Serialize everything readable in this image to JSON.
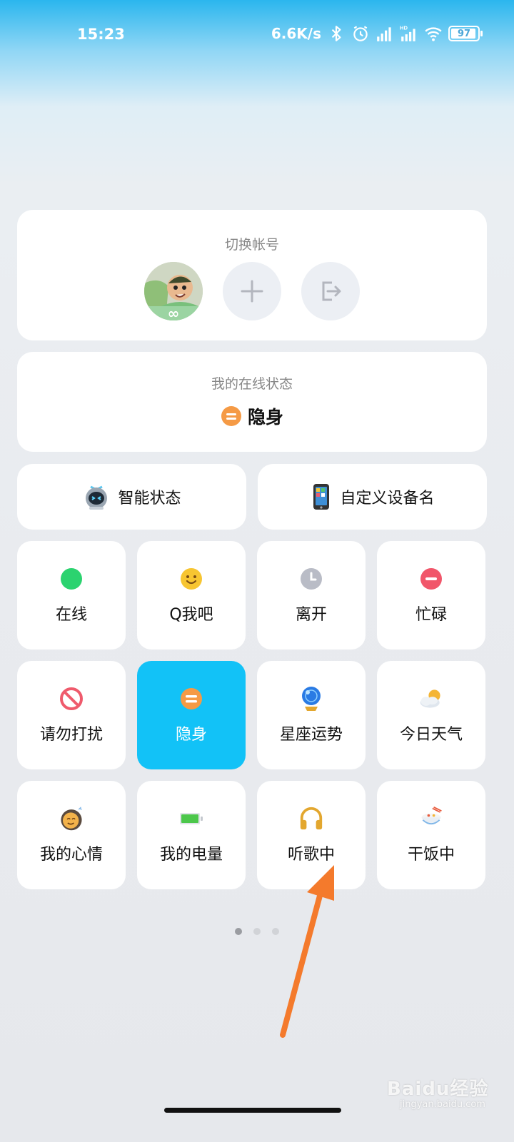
{
  "status_bar": {
    "time": "15:23",
    "network_speed": "6.6K/s",
    "battery": "97",
    "icons": [
      "bluetooth-icon",
      "alarm-icon",
      "signal-icon",
      "hd-signal-icon",
      "wifi-icon",
      "battery-icon"
    ]
  },
  "account": {
    "title": "切换帐号",
    "actions": [
      "add-account",
      "logout"
    ]
  },
  "online_status": {
    "title": "我的在线状态",
    "current": "隐身",
    "current_icon": "invisible-icon"
  },
  "quick": {
    "smart_status": "智能状态",
    "custom_device": "自定义设备名"
  },
  "tiles": [
    {
      "label": "在线",
      "icon": "online-dot-icon",
      "color": "#2bd36f"
    },
    {
      "label": "Q我吧",
      "icon": "smile-face-icon",
      "color": "#f7c531"
    },
    {
      "label": "离开",
      "icon": "clock-icon",
      "color": "#b9bcc6"
    },
    {
      "label": "忙碌",
      "icon": "busy-minus-icon",
      "color": "#f1566a"
    },
    {
      "label": "请勿打扰",
      "icon": "no-disturb-icon",
      "color": "#ef5a6c"
    },
    {
      "label": "隐身",
      "icon": "invisible-icon",
      "color": "#f59a45"
    },
    {
      "label": "星座运势",
      "icon": "crystal-ball-icon",
      "color": "#2a7be4"
    },
    {
      "label": "今日天气",
      "icon": "weather-icon",
      "color": "#f4b535"
    },
    {
      "label": "我的心情",
      "icon": "mood-icon",
      "color": "#f3b24a"
    },
    {
      "label": "我的电量",
      "icon": "battery-level-icon",
      "color": "#4cc74b"
    },
    {
      "label": "听歌中",
      "icon": "headphones-icon",
      "color": "#e3a72f"
    },
    {
      "label": "干饭中",
      "icon": "rice-bowl-icon",
      "color": "#e85a3c"
    }
  ],
  "pager": {
    "pages": 3,
    "current": 1
  },
  "watermark": {
    "text": "Baidu经验",
    "sub": "jingyan.baidu.com"
  }
}
